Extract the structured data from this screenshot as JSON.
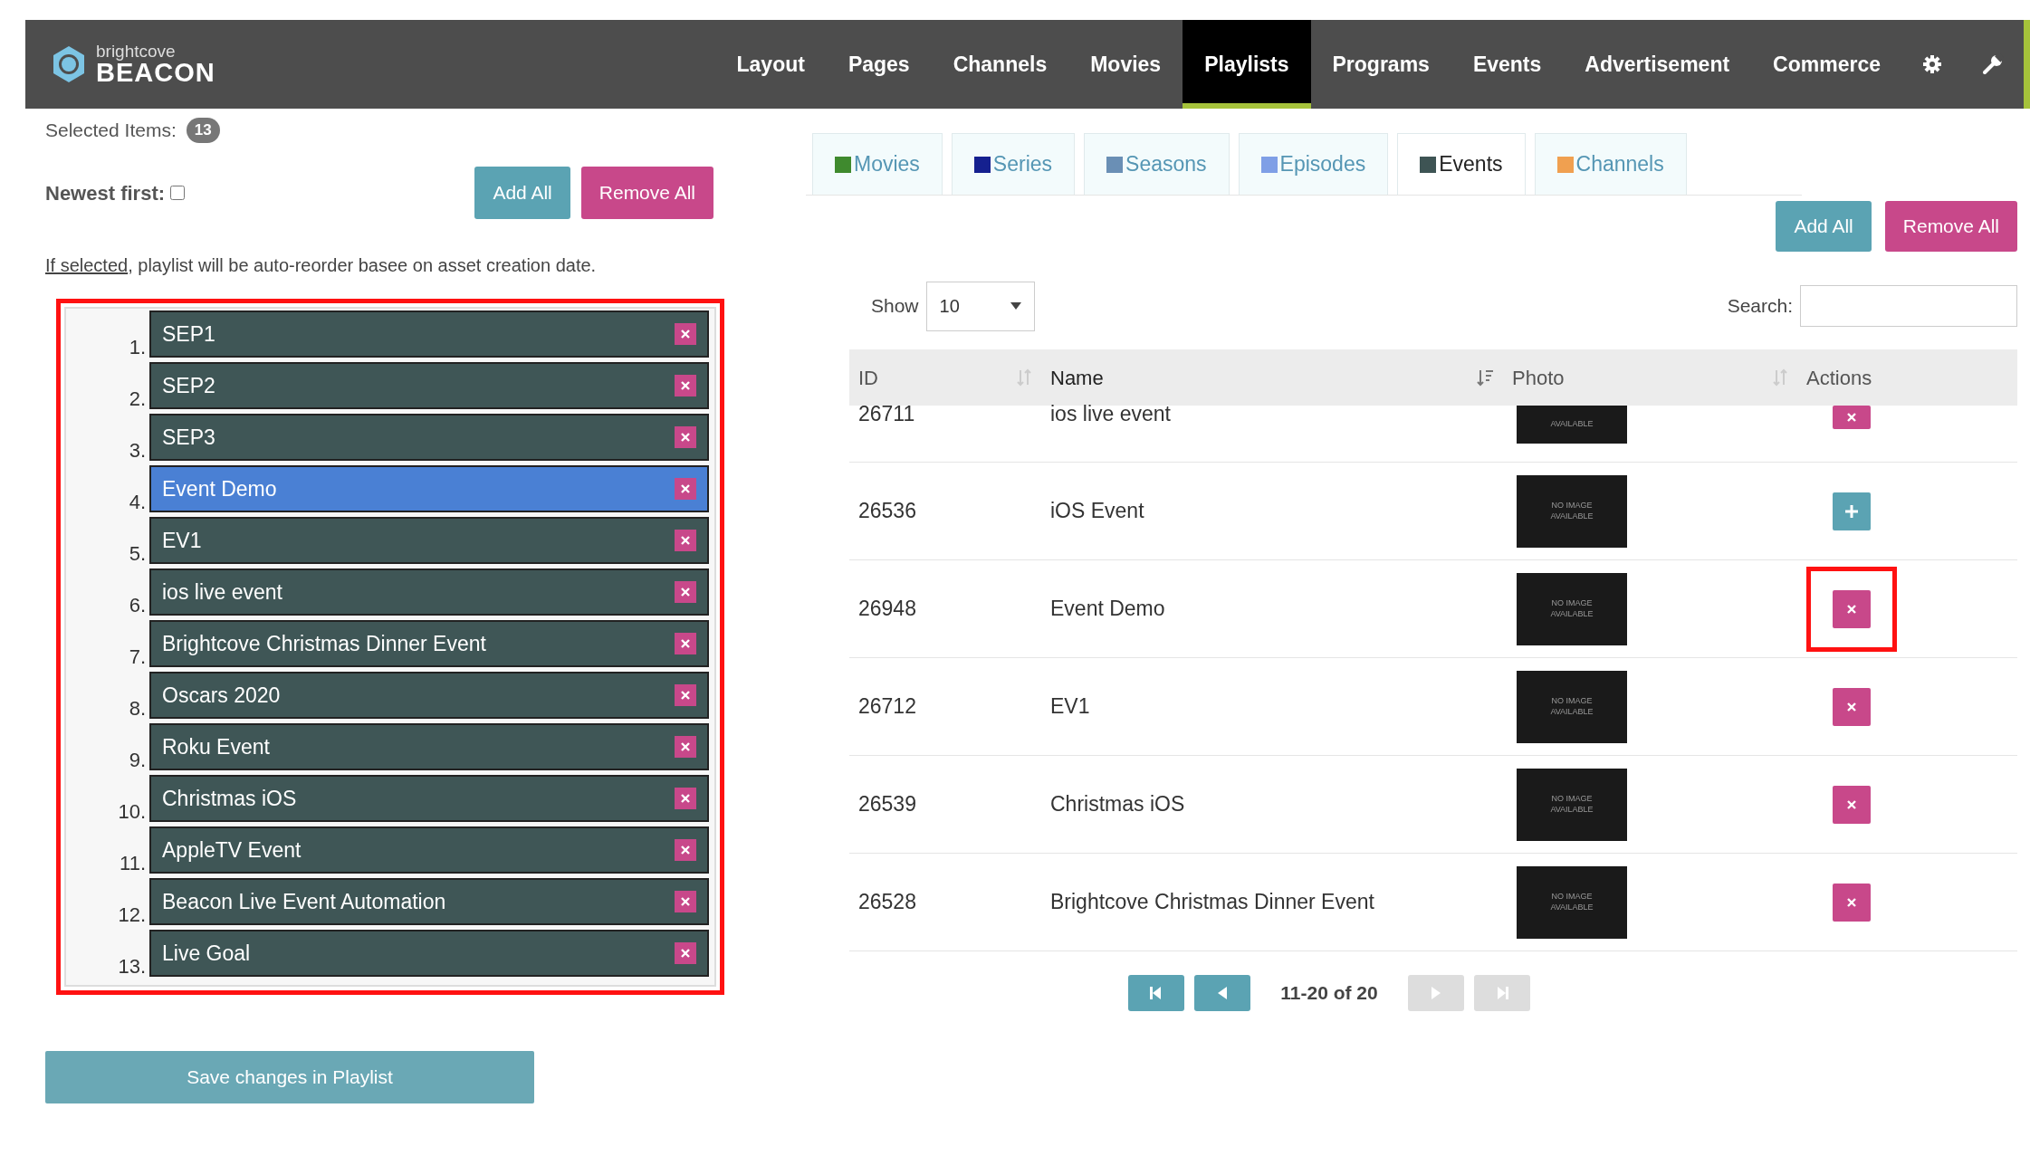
{
  "navbar": {
    "brand_small": "brightcove",
    "brand": "BEACON",
    "items": [
      {
        "label": "Layout",
        "selected": false
      },
      {
        "label": "Pages",
        "selected": false
      },
      {
        "label": "Channels",
        "selected": false
      },
      {
        "label": "Movies",
        "selected": false
      },
      {
        "label": "Playlists",
        "selected": true
      },
      {
        "label": "Programs",
        "selected": false
      },
      {
        "label": "Events",
        "selected": false
      },
      {
        "label": "Advertisement",
        "selected": false
      },
      {
        "label": "Commerce",
        "selected": false
      }
    ],
    "icons": [
      {
        "kind": "gear"
      },
      {
        "kind": "wrench"
      }
    ]
  },
  "playlist": {
    "selected_label": "Selected Items:",
    "selected_count": "13",
    "newest_label": "Newest first:",
    "newest_checked": false,
    "buttons": [
      {
        "kind": "add",
        "label": "Add All"
      },
      {
        "kind": "remove",
        "label": "Remove All"
      }
    ],
    "note_link": "If selected",
    "note_text": ", playlist will be auto-reorder basee on asset creation date.",
    "highlighted": true,
    "items": [
      {
        "number": "1.",
        "title": "SEP1",
        "selected": false
      },
      {
        "number": "2.",
        "title": "SEP2",
        "selected": false
      },
      {
        "number": "3.",
        "title": "SEP3",
        "selected": false
      },
      {
        "number": "4.",
        "title": "Event Demo",
        "selected": true
      },
      {
        "number": "5.",
        "title": "EV1",
        "selected": false
      },
      {
        "number": "6.",
        "title": "ios live event",
        "selected": false
      },
      {
        "number": "7.",
        "title": "Brightcove Christmas Dinner Event",
        "selected": false
      },
      {
        "number": "8.",
        "title": "Oscars 2020",
        "selected": false
      },
      {
        "number": "9.",
        "title": "Roku Event",
        "selected": false
      },
      {
        "number": "10.",
        "title": "Christmas iOS",
        "selected": false
      },
      {
        "number": "11.",
        "title": "AppleTV Event",
        "selected": false
      },
      {
        "number": "12.",
        "title": "Beacon Live Event Automation",
        "selected": false
      },
      {
        "number": "13.",
        "title": "Live Goal",
        "selected": false
      }
    ],
    "save_button": "Save changes in Playlist"
  },
  "content": {
    "tabs": [
      {
        "label": "Movies",
        "color": "#3f8a2e",
        "selected": false
      },
      {
        "label": "Series",
        "color": "#15208f",
        "selected": false
      },
      {
        "label": "Seasons",
        "color": "#6a8fb5",
        "selected": false
      },
      {
        "label": "Episodes",
        "color": "#7f9fe6",
        "selected": false
      },
      {
        "label": "Events",
        "color": "#3e5454",
        "selected": true
      },
      {
        "label": "Channels",
        "color": "#f0a050",
        "selected": false
      }
    ],
    "buttons": [
      {
        "kind": "add",
        "label": "Add All"
      },
      {
        "kind": "remove",
        "label": "Remove All"
      }
    ],
    "show_label": "Show",
    "page_size": "10",
    "search_label": "Search:",
    "table": {
      "columns": [
        {
          "label": "ID",
          "sortable": true,
          "sorted": false
        },
        {
          "label": "Name",
          "sortable": true,
          "sorted": true
        },
        {
          "label": "Photo",
          "sortable": true,
          "sorted": false
        },
        {
          "label": "Actions"
        }
      ],
      "rows": [
        {
          "id": "26711",
          "name": "ios live event",
          "photo_text": "AVAILABLE",
          "in_playlist": true,
          "highlighted": false,
          "cut": true
        },
        {
          "id": "26536",
          "name": "iOS Event",
          "photo_text": "NO IMAGE AVAILABLE",
          "in_playlist": false,
          "highlighted": false,
          "cut": false
        },
        {
          "id": "26948",
          "name": "Event Demo",
          "photo_text": "NO IMAGE AVAILABLE",
          "in_playlist": true,
          "highlighted": true,
          "cut": false
        },
        {
          "id": "26712",
          "name": "EV1",
          "photo_text": "NO IMAGE AVAILABLE",
          "in_playlist": true,
          "highlighted": false,
          "cut": false
        },
        {
          "id": "26539",
          "name": "Christmas iOS",
          "photo_text": "NO IMAGE AVAILABLE",
          "in_playlist": true,
          "highlighted": false,
          "cut": false
        },
        {
          "id": "26528",
          "name": "Brightcove Christmas Dinner Event",
          "photo_text": "NO IMAGE AVAILABLE",
          "in_playlist": true,
          "highlighted": false,
          "cut": false
        }
      ]
    },
    "pagination": {
      "buttons": [
        {
          "kind": "first",
          "disabled": false
        },
        {
          "kind": "prev",
          "disabled": false
        },
        {
          "kind": "next",
          "disabled": true
        },
        {
          "kind": "last",
          "disabled": true
        }
      ],
      "info": "11-20 of 20"
    }
  }
}
